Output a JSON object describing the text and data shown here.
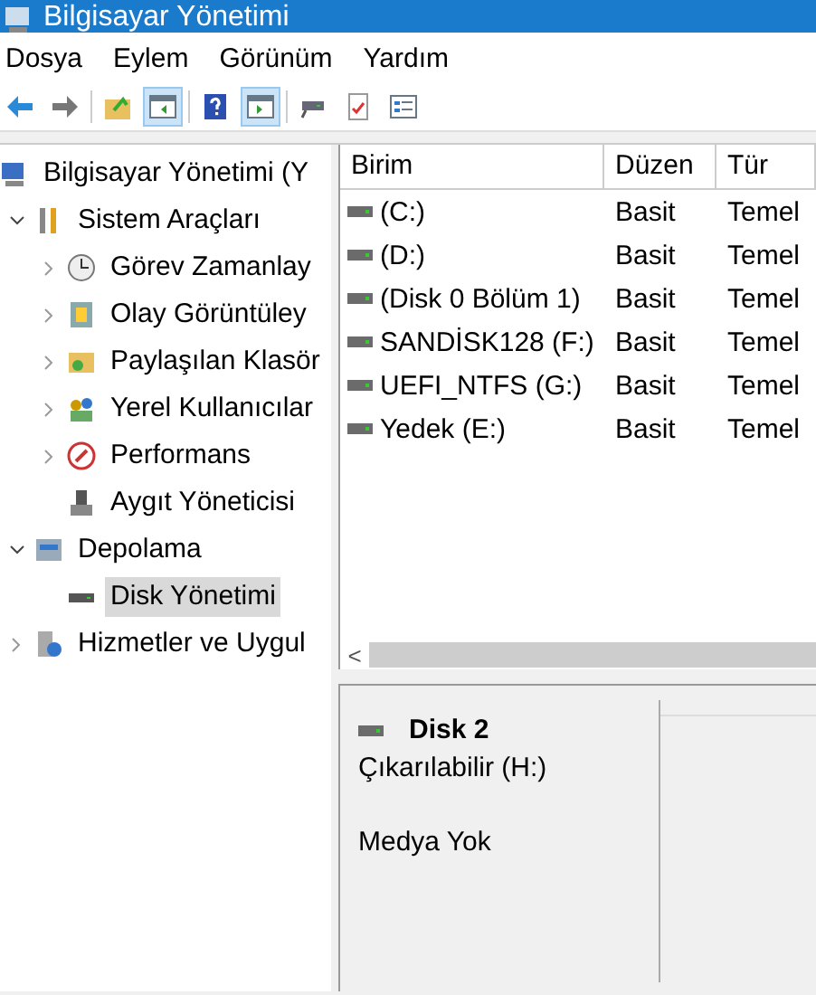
{
  "window": {
    "title": "Bilgisayar Yönetimi"
  },
  "menu": [
    "Dosya",
    "Eylem",
    "Görünüm",
    "Yardım"
  ],
  "toolbar": [
    {
      "kind": "back",
      "on": false
    },
    {
      "kind": "forward",
      "on": false
    },
    {
      "kind": "up",
      "on": false
    },
    {
      "kind": "tree",
      "on": true
    },
    {
      "kind": "help",
      "on": false
    },
    {
      "kind": "pane",
      "on": true
    },
    {
      "kind": "drive",
      "on": false
    },
    {
      "kind": "check",
      "on": false
    },
    {
      "kind": "list",
      "on": false
    }
  ],
  "tree": [
    {
      "label": "Bilgisayar Yönetimi (Y",
      "selected": false,
      "children": [
        {
          "label": "Sistem Araçları",
          "expanded": true,
          "selected": false,
          "children": [
            {
              "label": "Görev Zamanlay",
              "expanded": false,
              "selected": false
            },
            {
              "label": "Olay Görüntüley",
              "expanded": false,
              "selected": false
            },
            {
              "label": "Paylaşılan Klasör",
              "expanded": false,
              "selected": false
            },
            {
              "label": "Yerel Kullanıcılar",
              "expanded": false,
              "selected": false
            },
            {
              "label": "Performans",
              "expanded": false,
              "selected": false
            },
            {
              "label": "Aygıt Yöneticisi",
              "selected": false
            }
          ]
        },
        {
          "label": "Depolama",
          "expanded": true,
          "selected": false,
          "children": [
            {
              "label": "Disk Yönetimi",
              "selected": true
            }
          ]
        },
        {
          "label": "Hizmetler ve Uygul",
          "expanded": false,
          "selected": false
        }
      ]
    }
  ],
  "table": {
    "columns": [
      "Birim",
      "Düzen",
      "Tür"
    ],
    "rows": [
      [
        "(C:)",
        "Basit",
        "Temel"
      ],
      [
        "(D:)",
        "Basit",
        "Temel"
      ],
      [
        "(Disk 0 Bölüm 1)",
        "Basit",
        "Temel"
      ],
      [
        "SANDİSK128 (F:)",
        "Basit",
        "Temel"
      ],
      [
        "UEFI_NTFS (G:)",
        "Basit",
        "Temel"
      ],
      [
        "Yedek (E:)",
        "Basit",
        "Temel"
      ]
    ]
  },
  "scrollbar_arrow": "<",
  "disk": {
    "name": "Disk 2",
    "type": "Çıkarılabilir (H:)",
    "status": "Medya Yok"
  }
}
